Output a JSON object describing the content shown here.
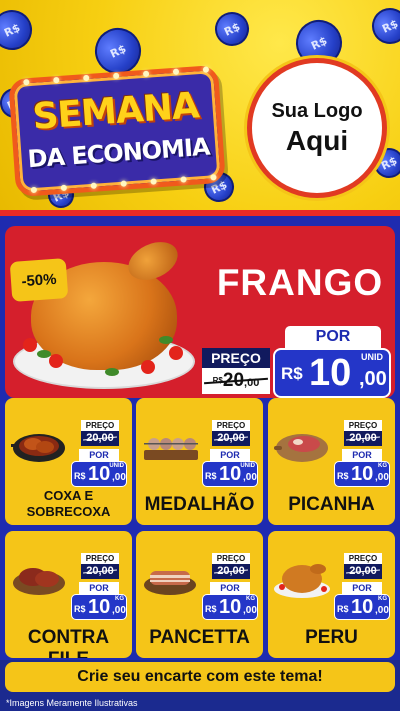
{
  "header": {
    "title_line1": "SEMANA",
    "title_line2": "DA ECONOMIA",
    "logo_line1": "Sua Logo",
    "logo_line2": "Aqui",
    "coin_label": "R$"
  },
  "featured": {
    "discount_badge": "-50%",
    "name": "FRANGO",
    "old_label": "PREÇO",
    "old_currency": "R$",
    "old_int": "20",
    "old_cents": ",00",
    "por_label": "POR",
    "new_currency": "R$",
    "new_int": "10",
    "new_cents": ",00",
    "unit": "UNID"
  },
  "products": [
    {
      "name": "COXA E SOBRECOXA",
      "old_label": "PREÇO",
      "old_price": "20,00",
      "por_label": "POR",
      "currency": "R$",
      "int": "10",
      "cents": ",00",
      "unit": "UNID"
    },
    {
      "name": "MEDALHÃO",
      "old_label": "PREÇO",
      "old_price": "20,00",
      "por_label": "POR",
      "currency": "R$",
      "int": "10",
      "cents": ",00",
      "unit": "UNID"
    },
    {
      "name": "PICANHA",
      "old_label": "PREÇO",
      "old_price": "20,00",
      "por_label": "POR",
      "currency": "R$",
      "int": "10",
      "cents": ",00",
      "unit": "KG"
    },
    {
      "name": "CONTRA FILE",
      "old_label": "PREÇO",
      "old_price": "20,00",
      "por_label": "POR",
      "currency": "R$",
      "int": "10",
      "cents": ",00",
      "unit": "KG"
    },
    {
      "name": "PANCETTA",
      "old_label": "PREÇO",
      "old_price": "20,00",
      "por_label": "POR",
      "currency": "R$",
      "int": "10",
      "cents": ",00",
      "unit": "KG"
    },
    {
      "name": "PERU",
      "old_label": "PREÇO",
      "old_price": "20,00",
      "por_label": "POR",
      "currency": "R$",
      "int": "10",
      "cents": ",00",
      "unit": "KG"
    }
  ],
  "footer": {
    "cta": "Crie seu encarte com este tema!",
    "disclaimer": "*Imagens Meramente Ilustrativas"
  },
  "colors": {
    "yellow": "#f5c518",
    "blue": "#1e2bb0",
    "red": "#d51f2c",
    "navy": "#111a5e"
  }
}
